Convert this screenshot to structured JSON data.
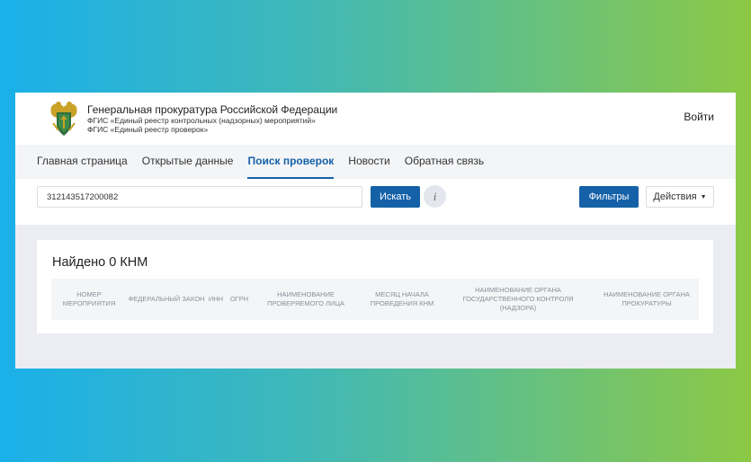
{
  "header": {
    "org_title": "Генеральная прокуратура Российской Федерации",
    "sub1": "ФГИС «Единый реестр контрольных (надзорных) мероприятий»",
    "sub2": "ФГИС «Единый реестр проверок»",
    "login": "Войти",
    "emblem_icon": "coat-of-arms-icon"
  },
  "nav": {
    "items": [
      {
        "label": "Главная страница"
      },
      {
        "label": "Открытые данные"
      },
      {
        "label": "Поиск проверок"
      },
      {
        "label": "Новости"
      },
      {
        "label": "Обратная связь"
      }
    ],
    "active_index": 2
  },
  "search": {
    "value": "312143517200082",
    "button": "Искать",
    "info": "i",
    "filters": "Фильтры",
    "actions": "Действия",
    "actions_icon": "caret-down-icon"
  },
  "results": {
    "title": "Найдено 0 КНМ",
    "columns": [
      "НОМЕР МЕРОПРИЯТИЯ",
      "ФЕДЕРАЛЬНЫЙ ЗАКОН",
      "ИНН",
      "ОГРН",
      "НАИМЕНОВАНИЕ ПРОВЕРЯЕМОГО ЛИЦА",
      "МЕСЯЦ НАЧАЛА ПРОВЕДЕНИЯ КНМ",
      "НАИМЕНОВАНИЕ ОРГАНА ГОСУДАРСТВЕННОГО КОНТРОЛЯ (НАДЗОРА)",
      "НАИМЕНОВАНИЕ ОРГАНА ПРОКУРАТУРЫ"
    ]
  },
  "colors": {
    "primary": "#1561a8",
    "bg_gradient_start": "#1ab0ea",
    "bg_gradient_end": "#8cc844"
  }
}
